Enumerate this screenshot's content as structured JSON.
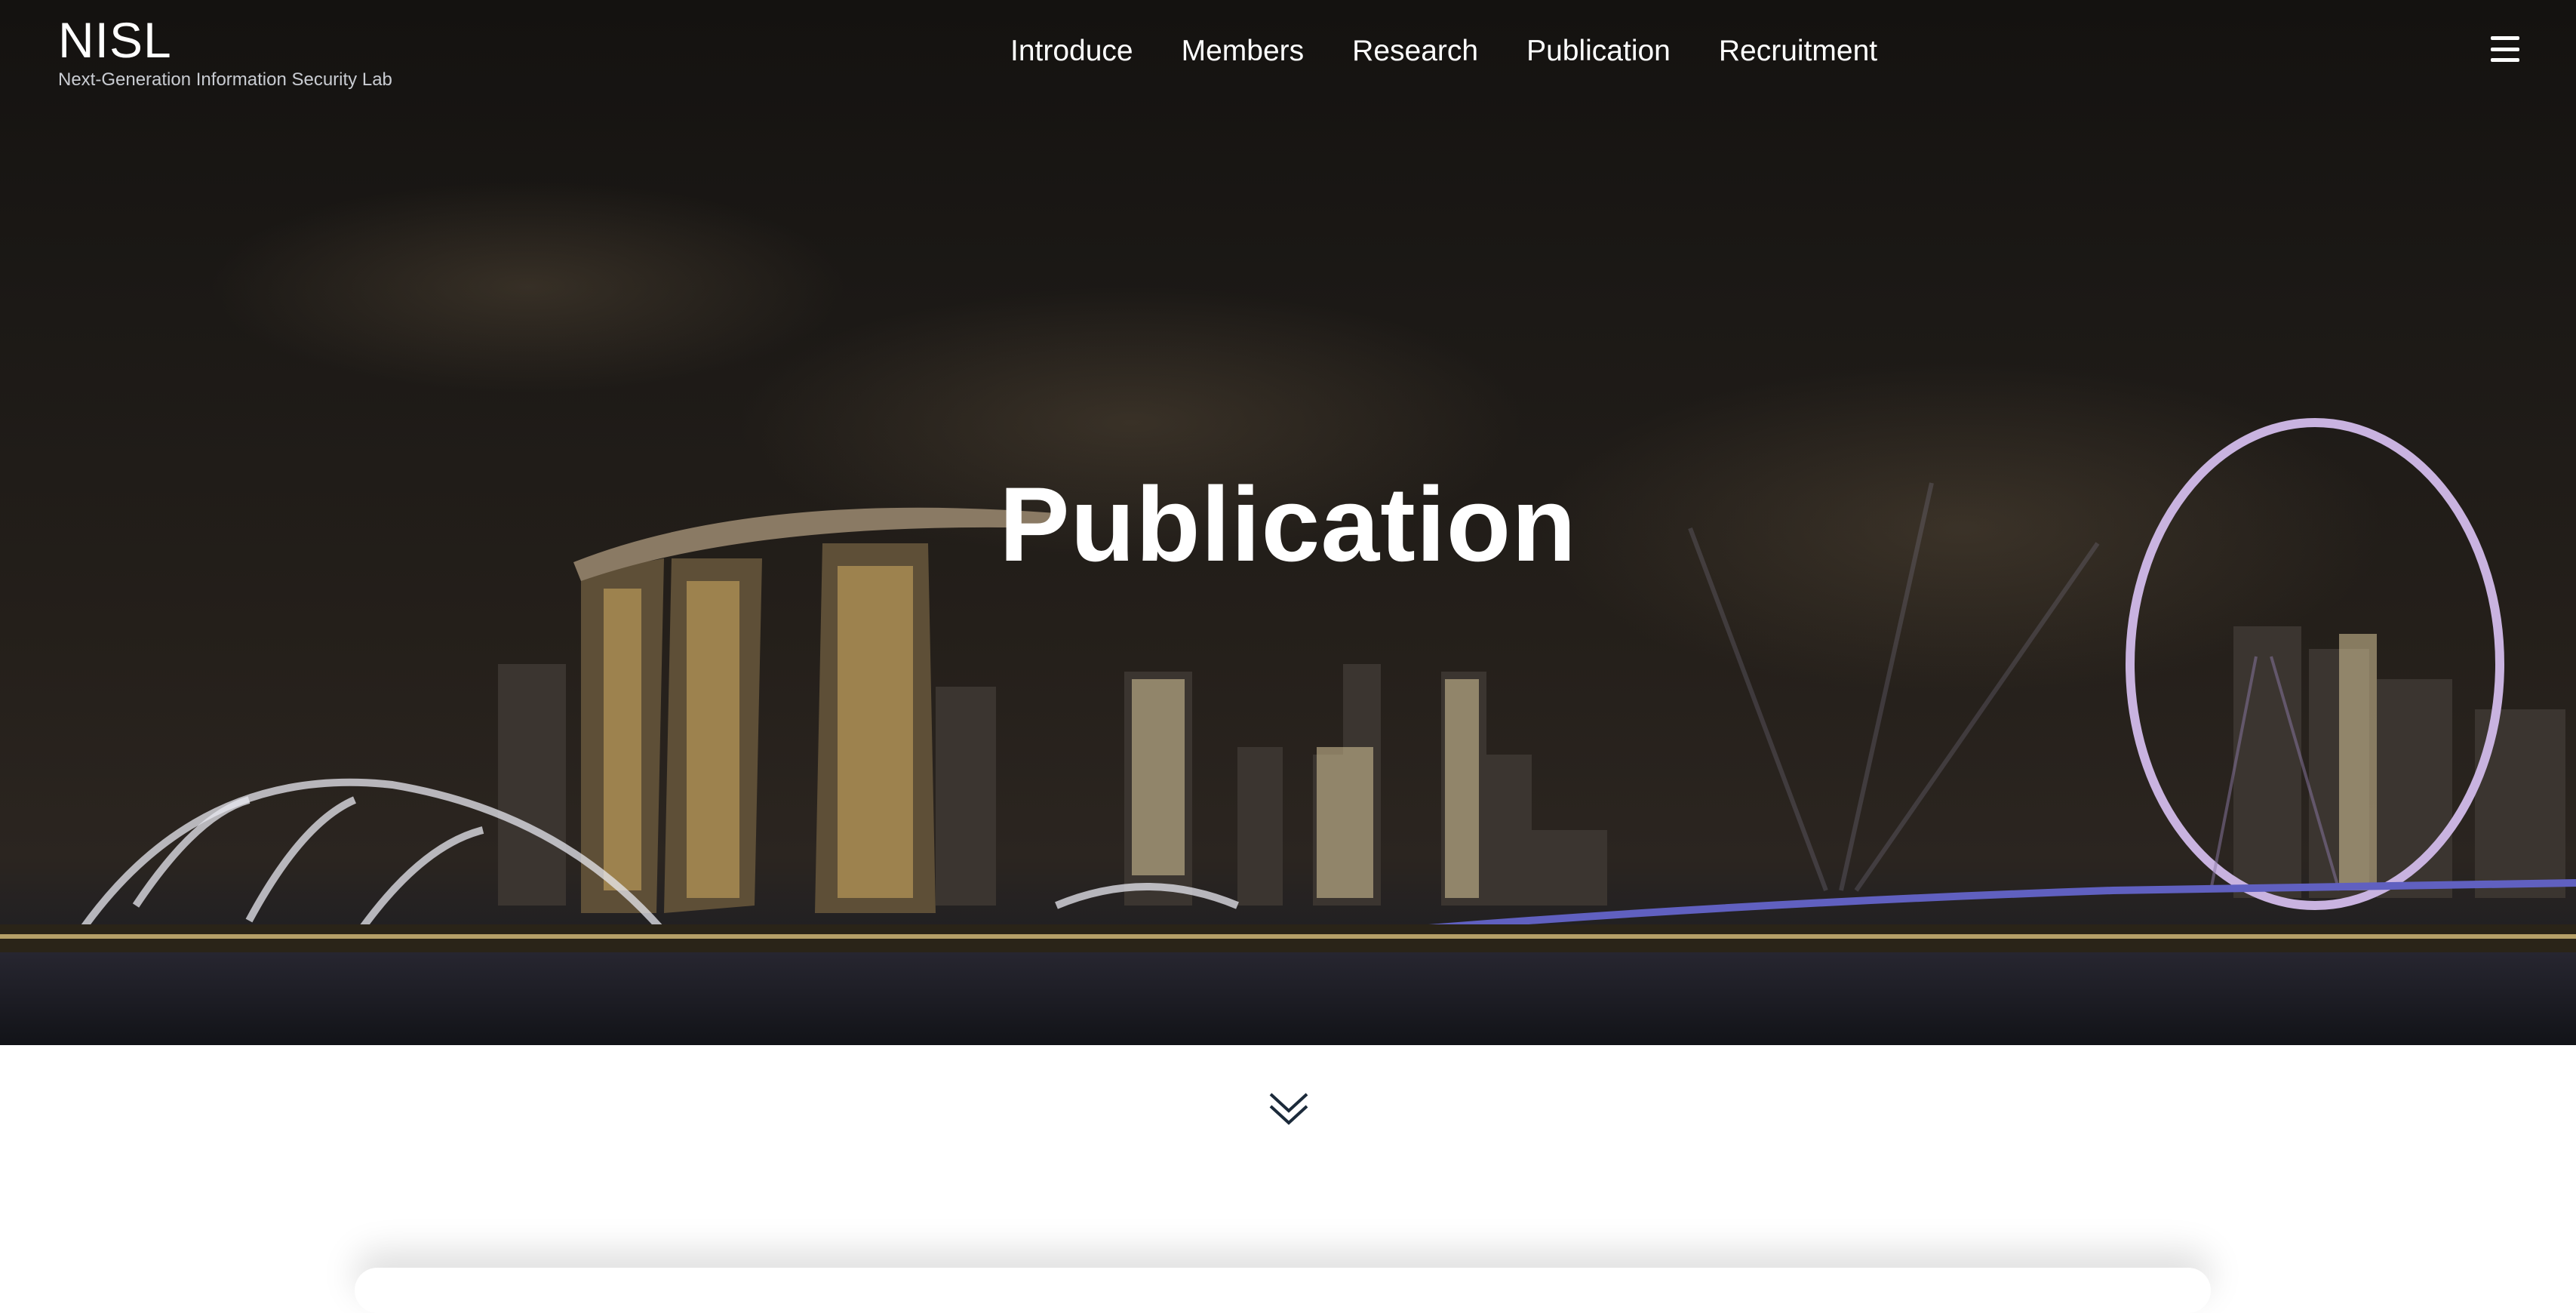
{
  "brand": {
    "title": "NISL",
    "subtitle": "Next-Generation Information Security Lab"
  },
  "nav": {
    "items": [
      "Introduce",
      "Members",
      "Research",
      "Publication",
      "Recruitment"
    ]
  },
  "menu_icon": "hamburger-menu-icon",
  "hero": {
    "title": "Publication",
    "background": "night city skyline"
  },
  "scroll_icon": "double-chevron-down-icon",
  "colors": {
    "hero_text": "#ffffff",
    "subtitle_text": "#c9ccd2",
    "page_background": "#ffffff"
  }
}
